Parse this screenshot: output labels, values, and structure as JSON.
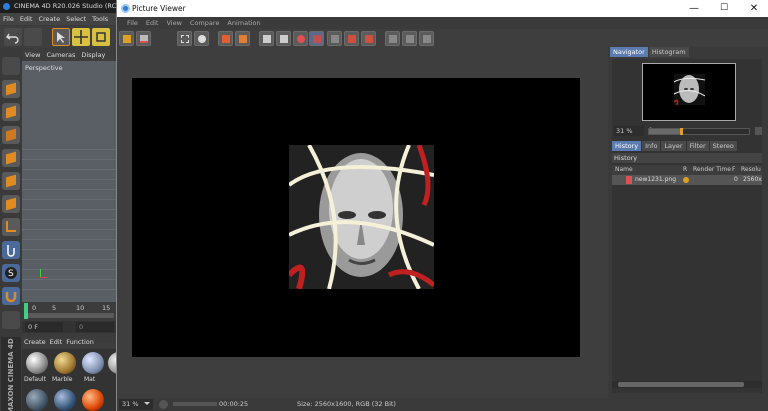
{
  "c4d": {
    "title": "CINEMA 4D R20.026 Studio (RC",
    "menu": [
      "File",
      "Edit",
      "Create",
      "Select",
      "Tools"
    ],
    "viewport_menu": [
      "View",
      "Cameras",
      "Display"
    ],
    "viewport_label": "Perspective",
    "timeline_ticks": [
      "0",
      "5",
      "10",
      "15"
    ],
    "frame_fields": [
      "0 F",
      "0"
    ],
    "material_menu": [
      "Create",
      "Edit",
      "Function"
    ],
    "materials": [
      "Default",
      "Marble",
      "Mat"
    ],
    "brand": "MAXON CINEMA 4D"
  },
  "picture_viewer": {
    "title": "Picture Viewer",
    "window_buttons": [
      "—",
      "☐",
      "✕"
    ],
    "menu": [
      "File",
      "Edit",
      "View",
      "Compare",
      "Animation"
    ],
    "navigator_tabs": [
      "Navigator",
      "Histogram"
    ],
    "nav_zoom": "31 %",
    "nav_zoom_value": "1",
    "history_tabs": [
      "History",
      "Info",
      "Layer",
      "Filter",
      "Stereo"
    ],
    "history_title": "History",
    "history_columns": [
      "Name",
      "R",
      "Render Time",
      "F",
      "Resolu"
    ],
    "history_rows": [
      {
        "name": "new1231.png",
        "time": "0",
        "resolution": "2560x"
      }
    ],
    "status": {
      "zoom": "31 %",
      "time": "00:00:25",
      "size": "Size: 2560x1600, RGB (32 Bit)"
    }
  },
  "colors": {
    "accent_tab": "#5a7cb0",
    "status_dot": "#e0a020",
    "file_marker": "#e05050",
    "canvas": "#000000"
  }
}
